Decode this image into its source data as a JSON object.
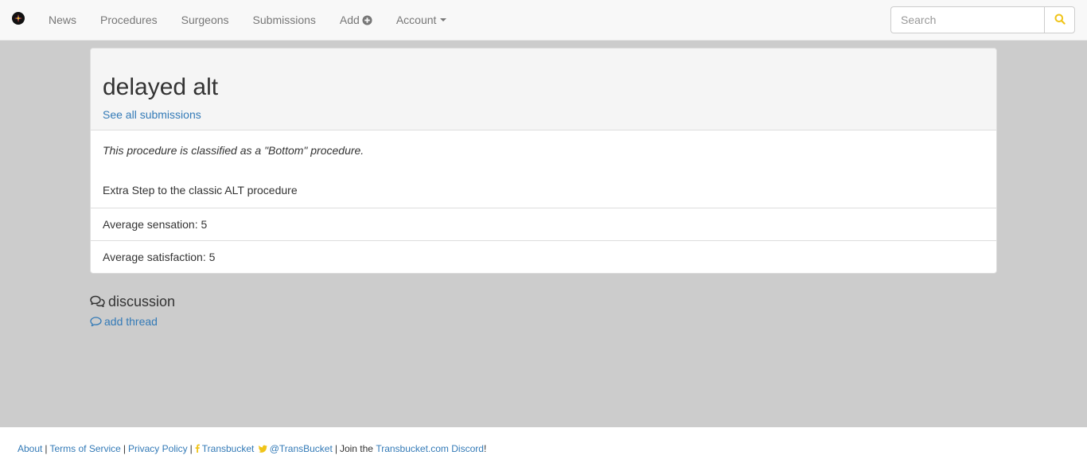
{
  "navbar": {
    "items": [
      {
        "label": "News"
      },
      {
        "label": "Procedures"
      },
      {
        "label": "Surgeons"
      },
      {
        "label": "Submissions"
      },
      {
        "label": "Add"
      },
      {
        "label": "Account"
      }
    ],
    "search_placeholder": "Search",
    "search_button_icon": "search-icon",
    "accent_color": "#f0c419"
  },
  "procedure": {
    "title": "delayed alt",
    "see_all_link": "See all submissions",
    "classification": "This procedure is classified as a \"Bottom\" procedure.",
    "description": "Extra Step to the classic ALT procedure",
    "average_sensation": "Average sensation: 5",
    "average_satisfaction": "Average satisfaction: 5"
  },
  "discussion": {
    "title": "discussion",
    "add_thread": "add thread"
  },
  "footer": {
    "about": "About",
    "terms": "Terms of Service",
    "privacy": "Privacy Policy",
    "facebook": "Transbucket",
    "twitter": "@TransBucket",
    "join_prefix": "Join the",
    "discord": "Transbucket.com Discord",
    "join_suffix": "!"
  }
}
